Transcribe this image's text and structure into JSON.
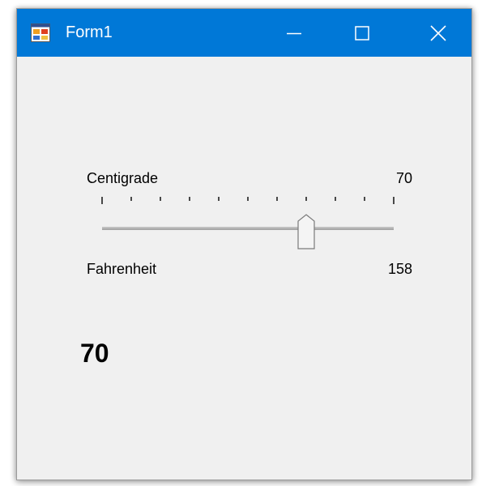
{
  "window": {
    "title": "Form1",
    "controls": [
      "minimize-icon",
      "maximize-icon",
      "close-icon"
    ],
    "accent_color": "#0078d7",
    "background_color": "#f0f0f0"
  },
  "centigrade": {
    "label": "Centigrade",
    "value": "70"
  },
  "trackbar": {
    "minimum": 0,
    "maximum": 100,
    "value": 70,
    "tick_count": 11
  },
  "fahrenheit": {
    "label": "Fahrenheit",
    "value": "158"
  },
  "display": {
    "value": "70"
  }
}
